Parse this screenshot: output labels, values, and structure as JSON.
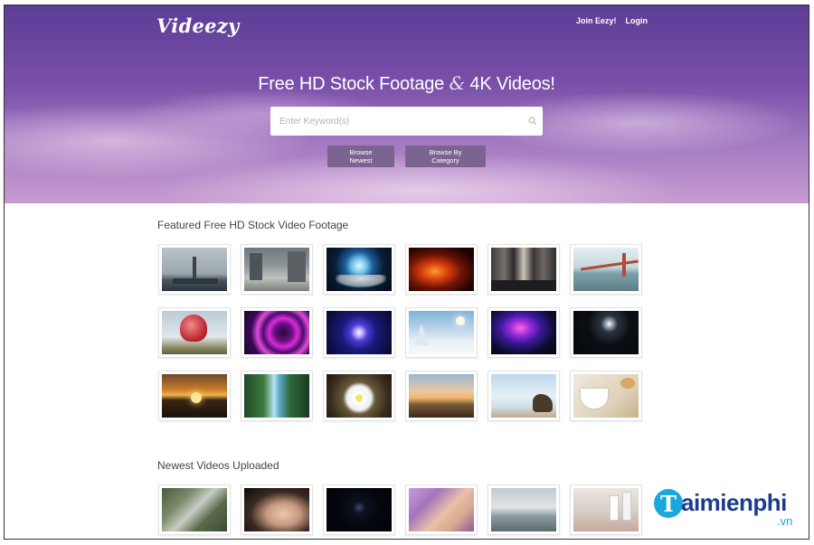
{
  "header": {
    "logo": "Videezy",
    "nav": [
      {
        "label": "Join Eezy!"
      },
      {
        "label": "Login"
      }
    ]
  },
  "hero": {
    "title_part1": "Free HD Stock Footage ",
    "title_amp": "&",
    "title_part2": " 4K Videos!",
    "search_placeholder": "Enter Keyword(s)",
    "buttons": {
      "browse_newest": "Browse Newest",
      "browse_category": "Browse By Category"
    }
  },
  "sections": {
    "featured_title": "Featured Free HD Stock Video Footage",
    "newest_title": "Newest Videos Uploaded"
  },
  "featured_thumbnails": [
    {
      "name": "statue-of-liberty"
    },
    {
      "name": "city-street"
    },
    {
      "name": "glowing-globe-hands"
    },
    {
      "name": "fire-sparks"
    },
    {
      "name": "times-square"
    },
    {
      "name": "golden-gate-bridge"
    },
    {
      "name": "heart-hot-air-balloon"
    },
    {
      "name": "neon-rings"
    },
    {
      "name": "blue-energy-orb"
    },
    {
      "name": "snowy-trees"
    },
    {
      "name": "purple-smoke"
    },
    {
      "name": "light-flare-dark"
    },
    {
      "name": "sunset-lake"
    },
    {
      "name": "waterfall-forest"
    },
    {
      "name": "white-flower"
    },
    {
      "name": "desert-sunset"
    },
    {
      "name": "beach-rocks"
    },
    {
      "name": "tea-cup"
    }
  ],
  "newest_thumbnails": [
    {
      "name": "aerial-neighborhood"
    },
    {
      "name": "hand-wrinkles"
    },
    {
      "name": "dark-particles"
    },
    {
      "name": "face-cream"
    },
    {
      "name": "ocean-shore"
    },
    {
      "name": "medicine-bottles"
    }
  ],
  "watermark": {
    "letter": "T",
    "text": "aimienphi",
    "suffix": ".vn"
  },
  "colors": {
    "hero_top": "#5b3d97",
    "hero_bottom": "#c79bd0",
    "button_bg": "#7b6590",
    "watermark_blue": "#1b3c8a",
    "watermark_cyan": "#1aa7dc"
  }
}
